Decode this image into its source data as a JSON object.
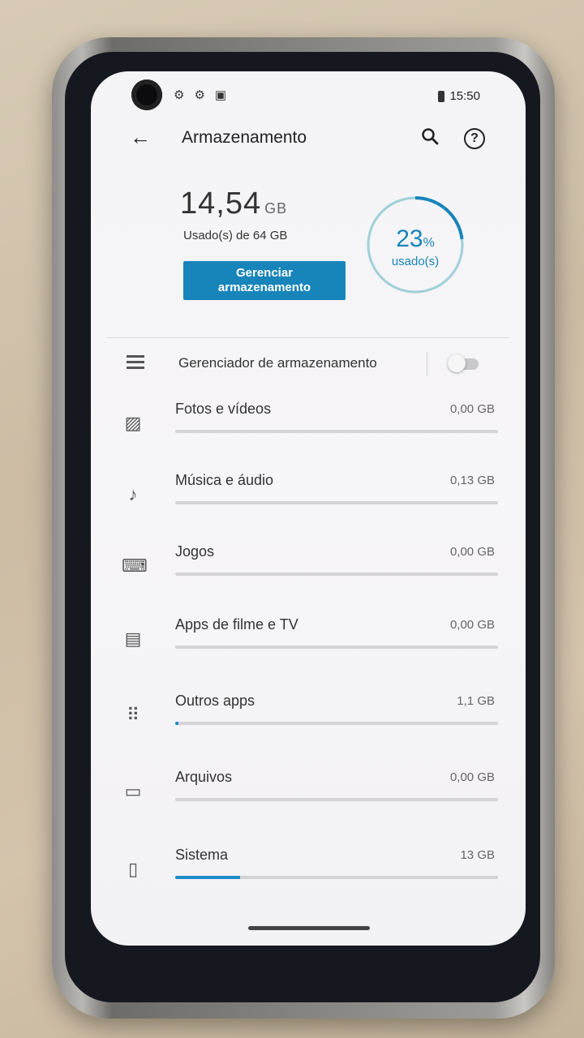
{
  "status_bar": {
    "left_icons": [
      "gear-icon",
      "gear-icon",
      "sim-icon"
    ],
    "time": "15:50"
  },
  "appbar": {
    "title": "Armazenamento",
    "back_icon": "arrow-back-icon",
    "search_icon": "search-icon",
    "help_icon": "help-icon",
    "help_glyph": "?"
  },
  "summary": {
    "used_value": "14,54",
    "used_unit": "GB",
    "used_sub": "Usado(s) de 64 GB",
    "manage_button": "Gerenciar armazenamento",
    "percent": "23",
    "percent_symbol": "%",
    "percent_label": "usado(s)",
    "percent_fraction": 0.23,
    "accent_color": "#1784ba"
  },
  "storage_manager": {
    "label": "Gerenciador de armazenamento",
    "enabled": false
  },
  "categories": [
    {
      "label": "Fotos e vídeos",
      "size": "0,00 GB",
      "fill": 0.0,
      "icon": "photo-icon"
    },
    {
      "label": "Música e áudio",
      "size": "0,13 GB",
      "fill": 0.0,
      "icon": "music-note-icon"
    },
    {
      "label": "Jogos",
      "size": "0,00 GB",
      "fill": 0.0,
      "icon": "gamepad-icon"
    },
    {
      "label": "Apps de filme e TV",
      "size": "0,00 GB",
      "fill": 0.0,
      "icon": "clapperboard-icon"
    },
    {
      "label": "Outros apps",
      "size": "1,1 GB",
      "fill": 0.01,
      "icon": "apps-grid-icon"
    },
    {
      "label": "Arquivos",
      "size": "0,00 GB",
      "fill": 0.0,
      "icon": "folder-icon"
    },
    {
      "label": "Sistema",
      "size": "13 GB",
      "fill": 0.2,
      "icon": "system-update-icon"
    }
  ]
}
